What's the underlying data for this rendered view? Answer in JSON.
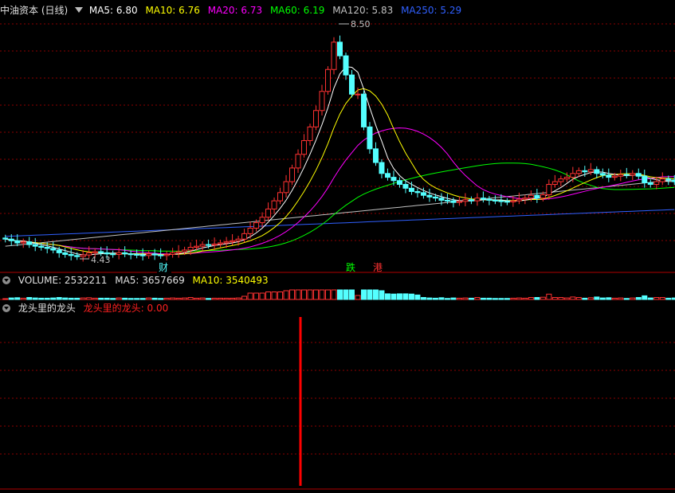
{
  "header": {
    "title": "中油资本 (日线)",
    "ma": [
      {
        "label": "MA5: 6.80",
        "color": "#ffffff"
      },
      {
        "label": "MA10: 6.76",
        "color": "#ffff00"
      },
      {
        "label": "MA20: 6.73",
        "color": "#ff00ff"
      },
      {
        "label": "MA60: 6.19",
        "color": "#00ff00"
      },
      {
        "label": "MA120: 5.83",
        "color": "#c0c0c0"
      },
      {
        "label": "MA250: 5.29",
        "color": "#3060ff"
      }
    ]
  },
  "volume_header": {
    "label": "VOLUME: 2532211",
    "ma5": "MA5: 3657669",
    "ma10": "MA10: 3540493"
  },
  "indicator_header": {
    "title": "龙头里的龙头",
    "value": "龙头里的龙头: 0.00"
  },
  "annotations": {
    "high": "8.50",
    "low": "4.43",
    "marker_cai": "财",
    "marker_die": "跌",
    "marker_gang": "港"
  },
  "colors": {
    "up": "#ff3232",
    "down": "#54ffff",
    "grid": "#8b0000",
    "signal": "#ff0000"
  },
  "chart_data": {
    "type": "candlestick",
    "ylim": [
      4.2,
      8.8
    ],
    "high_label": 8.5,
    "low_label": 4.43,
    "closes": [
      4.75,
      4.72,
      4.68,
      4.7,
      4.65,
      4.62,
      4.6,
      4.58,
      4.55,
      4.5,
      4.47,
      4.45,
      4.43,
      4.46,
      4.5,
      4.52,
      4.5,
      4.48,
      4.47,
      4.5,
      4.48,
      4.47,
      4.46,
      4.45,
      4.48,
      4.46,
      4.45,
      4.47,
      4.5,
      4.52,
      4.55,
      4.6,
      4.62,
      4.65,
      4.64,
      4.66,
      4.68,
      4.7,
      4.72,
      4.75,
      4.85,
      4.95,
      5.05,
      5.15,
      5.3,
      5.45,
      5.6,
      5.8,
      6.05,
      6.3,
      6.55,
      6.8,
      7.1,
      7.45,
      7.85,
      8.35,
      8.1,
      7.75,
      7.4,
      7.4,
      6.8,
      6.4,
      6.15,
      5.95,
      5.88,
      5.82,
      5.75,
      5.68,
      5.62,
      5.6,
      5.55,
      5.52,
      5.5,
      5.46,
      5.45,
      5.42,
      5.44,
      5.47,
      5.45,
      5.5,
      5.48,
      5.46,
      5.45,
      5.44,
      5.43,
      5.45,
      5.48,
      5.5,
      5.55,
      5.5,
      5.56,
      5.75,
      5.8,
      5.85,
      5.88,
      5.95,
      6.0,
      5.98,
      6.02,
      5.95,
      5.92,
      5.88,
      5.9,
      5.93,
      5.92,
      5.95,
      5.9,
      5.78,
      5.75,
      5.8,
      5.85,
      5.83,
      5.8
    ]
  }
}
